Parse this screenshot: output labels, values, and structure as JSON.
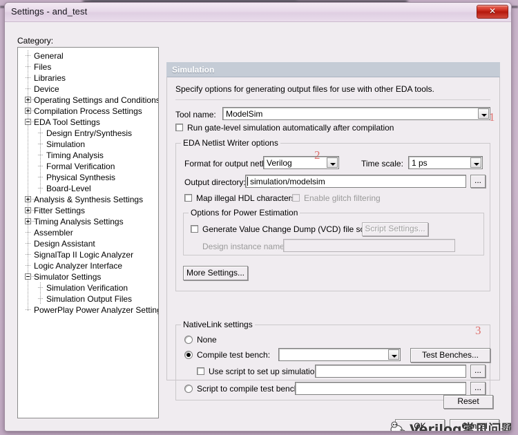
{
  "window": {
    "title": "Settings - and_test",
    "close_label": "✕"
  },
  "category": {
    "label": "Category:",
    "items": [
      {
        "label": "General",
        "depth": 1,
        "toggle": "none"
      },
      {
        "label": "Files",
        "depth": 1,
        "toggle": "none"
      },
      {
        "label": "Libraries",
        "depth": 1,
        "toggle": "none"
      },
      {
        "label": "Device",
        "depth": 1,
        "toggle": "none"
      },
      {
        "label": "Operating Settings and Conditions",
        "depth": 1,
        "toggle": "plus"
      },
      {
        "label": "Compilation Process Settings",
        "depth": 1,
        "toggle": "plus"
      },
      {
        "label": "EDA Tool Settings",
        "depth": 1,
        "toggle": "minus"
      },
      {
        "label": "Design Entry/Synthesis",
        "depth": 2,
        "toggle": "none"
      },
      {
        "label": "Simulation",
        "depth": 2,
        "toggle": "none"
      },
      {
        "label": "Timing Analysis",
        "depth": 2,
        "toggle": "none"
      },
      {
        "label": "Formal Verification",
        "depth": 2,
        "toggle": "none"
      },
      {
        "label": "Physical Synthesis",
        "depth": 2,
        "toggle": "none"
      },
      {
        "label": "Board-Level",
        "depth": 2,
        "toggle": "none"
      },
      {
        "label": "Analysis & Synthesis Settings",
        "depth": 1,
        "toggle": "plus"
      },
      {
        "label": "Fitter Settings",
        "depth": 1,
        "toggle": "plus"
      },
      {
        "label": "Timing Analysis Settings",
        "depth": 1,
        "toggle": "plus"
      },
      {
        "label": "Assembler",
        "depth": 1,
        "toggle": "none"
      },
      {
        "label": "Design Assistant",
        "depth": 1,
        "toggle": "none"
      },
      {
        "label": "SignalTap II Logic Analyzer",
        "depth": 1,
        "toggle": "none"
      },
      {
        "label": "Logic Analyzer Interface",
        "depth": 1,
        "toggle": "none"
      },
      {
        "label": "Simulator Settings",
        "depth": 1,
        "toggle": "minus"
      },
      {
        "label": "Simulation Verification",
        "depth": 2,
        "toggle": "none"
      },
      {
        "label": "Simulation Output Files",
        "depth": 2,
        "toggle": "none"
      },
      {
        "label": "PowerPlay Power Analyzer Settings",
        "depth": 1,
        "toggle": "none"
      }
    ]
  },
  "pane": {
    "header": "Simulation",
    "description": "Specify options for generating output files for use with other EDA tools.",
    "tool_name_label": "Tool name:",
    "tool_name_value": "ModelSim",
    "run_gate_level_label": "Run gate-level simulation automatically after compilation",
    "run_gate_level_checked": false
  },
  "netlist_group": {
    "caption": "EDA Netlist Writer options",
    "format_label": "Format for output netlist:",
    "format_value": "Verilog",
    "timescale_label": "Time scale:",
    "timescale_value": "1 ps",
    "output_dir_label": "Output directory:",
    "output_dir_value": "simulation/modelsim",
    "browse_label": "...",
    "map_illegal_label": "Map illegal HDL characters",
    "map_illegal_checked": false,
    "glitch_label": "Enable glitch filtering",
    "glitch_checked": false,
    "glitch_disabled": true
  },
  "power_group": {
    "caption": "Options for Power Estimation",
    "vcd_label": "Generate Value Change Dump (VCD) file script",
    "vcd_checked": false,
    "script_settings_label": "Script Settings...",
    "script_settings_disabled": true,
    "instance_label": "Design instance name:",
    "instance_value": "",
    "instance_disabled": true
  },
  "more_settings_label": "More Settings...",
  "nativelink": {
    "caption": "NativeLink settings",
    "none_label": "None",
    "compile_tb_label": "Compile test bench:",
    "compile_tb_value": "",
    "test_benches_label": "Test Benches...",
    "use_script_label": "Use script to set up simulation:",
    "use_script_checked": false,
    "use_script_value": "",
    "script_compile_label": "Script to compile test bench:",
    "script_compile_value": "",
    "browse_label": "...",
    "selected": "compile_test_bench"
  },
  "footer": {
    "reset_label": "Reset",
    "ok_label": "OK",
    "cancel_label": "Cancel"
  },
  "annotations": [
    {
      "id": "1",
      "text": "1"
    },
    {
      "id": "2",
      "text": "2"
    },
    {
      "id": "3",
      "text": "3"
    }
  ],
  "watermark": {
    "text": "Verilog常见问题"
  },
  "colors": {
    "titlebar": "#e8daea",
    "close_red": "#b5180d",
    "pane_header": "#c5ccd6",
    "dialog_face": "#f0ecf0",
    "annotation_red": "#d9534f"
  }
}
